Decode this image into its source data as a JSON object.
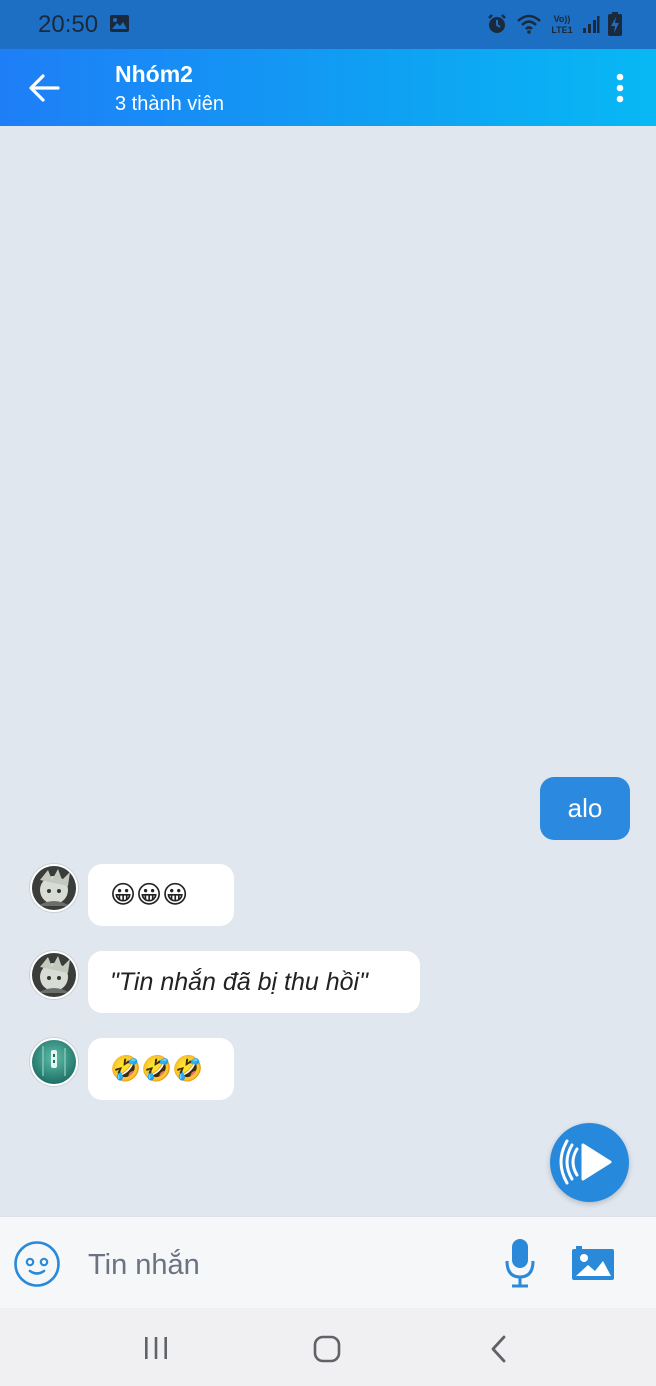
{
  "status_bar": {
    "time": "20:50",
    "network_label": "Vo)) LTE1",
    "icons": [
      "gallery-icon",
      "alarm-icon",
      "wifi-icon",
      "volte-lte-icon",
      "signal-icon",
      "battery-charging-icon"
    ]
  },
  "header": {
    "title": "Nhóm2",
    "subtitle": "3 thành viên",
    "back_icon": "arrow-left-icon",
    "menu_icon": "more-vertical-icon",
    "gradient_start": "#1e7ef7",
    "gradient_end": "#08b8f4"
  },
  "messages": [
    {
      "direction": "outgoing",
      "text": "alo"
    },
    {
      "direction": "incoming",
      "avatar": "avatar-anime",
      "text": "😀😀😀"
    },
    {
      "direction": "incoming",
      "avatar": "avatar-anime",
      "text": "\"Tin nhắn đã bị thu hồi\""
    },
    {
      "direction": "incoming",
      "avatar": "avatar-teal",
      "text": "🤣🤣🤣"
    }
  ],
  "composer": {
    "placeholder": "Tin nhắn",
    "emoji_icon": "smiley-icon",
    "mic_icon": "microphone-icon",
    "image_icon": "image-icon",
    "audio_fab_icon": "audio-play-icon"
  },
  "colors": {
    "chat_background": "#e1e7ef",
    "outgoing_bubble": "#2b8ae0",
    "accent": "#2789dc"
  },
  "nav_bar": {
    "icons": [
      "recent-apps-icon",
      "home-icon",
      "back-icon"
    ]
  }
}
